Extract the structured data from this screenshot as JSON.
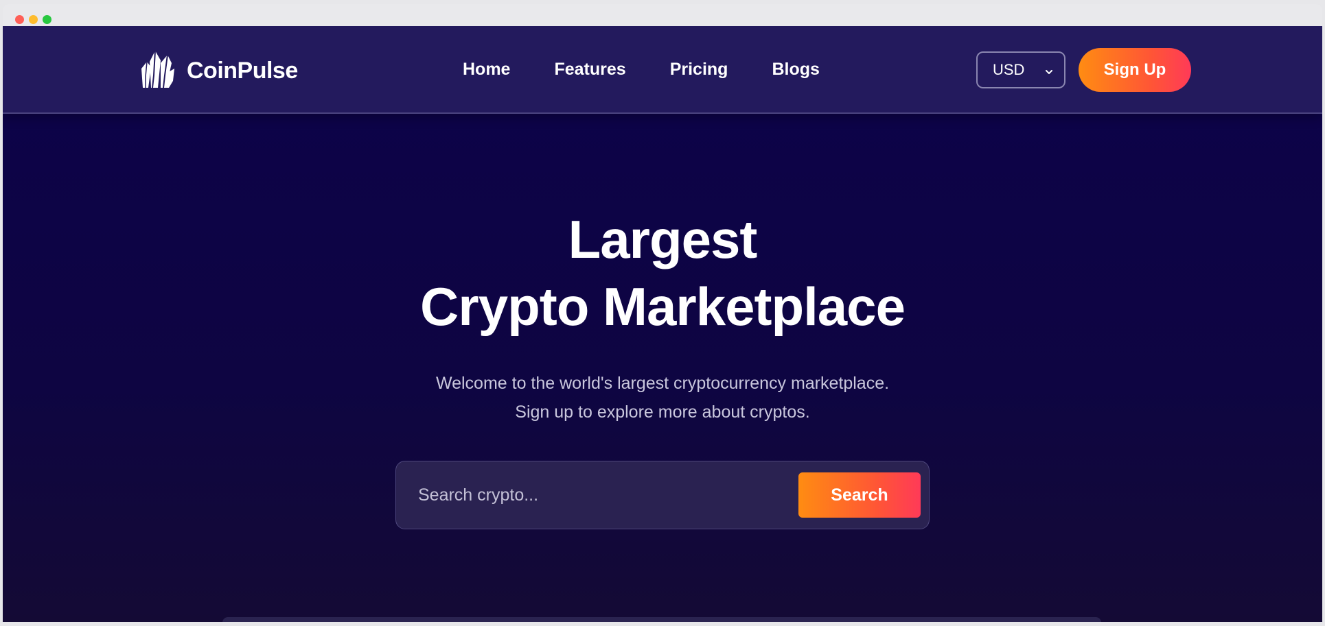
{
  "brand": {
    "name": "CoinPulse",
    "logo_icon": "crystal-icon"
  },
  "nav": {
    "links": [
      "Home",
      "Features",
      "Pricing",
      "Blogs"
    ]
  },
  "currency": {
    "selected": "USD"
  },
  "signup_label": "Sign Up",
  "hero": {
    "title_line1": "Largest",
    "title_line2": "Crypto Marketplace",
    "subtitle_line1": "Welcome to the world's largest cryptocurrency marketplace.",
    "subtitle_line2": "Sign up to explore more about cryptos."
  },
  "search": {
    "placeholder": "Search crypto...",
    "button_label": "Search"
  },
  "colors": {
    "background": "#0c024a",
    "navbar": "#231a5d",
    "accent_start": "#ff8c12",
    "accent_end": "#ff3a58"
  }
}
